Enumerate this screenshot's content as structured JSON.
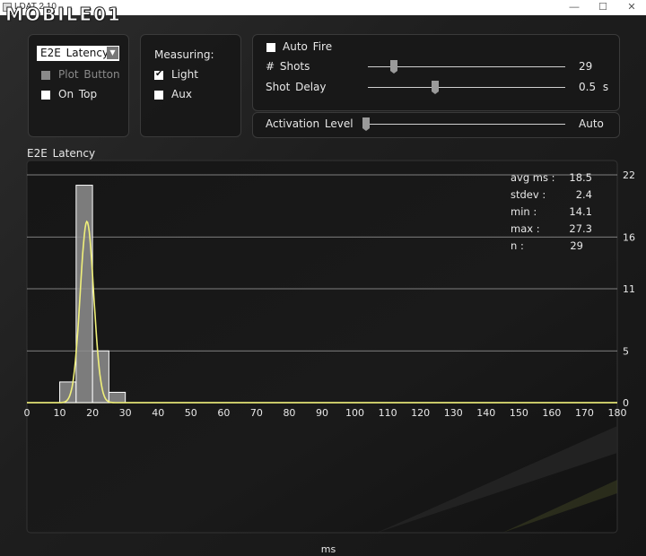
{
  "window": {
    "title": "LDAT 2.10",
    "minimize": "—",
    "maximize": "☐",
    "close": "✕"
  },
  "logo": {
    "text": "MOBILE01"
  },
  "source_panel": {
    "dropdown_value": "E2E Latency",
    "plot_button_label": "Plot Button",
    "plot_button_checked": false,
    "plot_button_enabled": false,
    "on_top_label": "On Top",
    "on_top_checked": false
  },
  "measuring_panel": {
    "heading": "Measuring:",
    "light_label": "Light",
    "light_checked": true,
    "aux_label": "Aux",
    "aux_checked": false
  },
  "fire_panel": {
    "auto_fire_label": "Auto Fire",
    "auto_fire_checked": false,
    "shots_label": "# Shots",
    "shots_value": "29",
    "shots_slider_fraction": 0.13,
    "shot_delay_label": "Shot Delay",
    "shot_delay_value": "0.5 s",
    "shot_delay_slider_fraction": 0.34
  },
  "activation_panel": {
    "label": "Activation Level",
    "value": "Auto",
    "slider_fraction": 0.0
  },
  "stats": {
    "avg_label": "avg ms :",
    "avg_value": "18.5",
    "stdev_label": "stdev :",
    "stdev_value": "2.4",
    "min_label": "min :",
    "min_value": "14.1",
    "max_label": "max :",
    "max_value": "27.3",
    "n_label": "n :",
    "n_value": "29"
  },
  "chart_data": {
    "type": "bar",
    "title": "E2E Latency",
    "xlabel": "ms",
    "ylabel": "",
    "xlim": [
      0,
      180
    ],
    "ylim": [
      0,
      22
    ],
    "x_ticks": [
      0,
      10,
      20,
      30,
      40,
      50,
      60,
      70,
      80,
      90,
      100,
      110,
      120,
      130,
      140,
      150,
      160,
      170,
      180
    ],
    "y_ticks": [
      0,
      5,
      11,
      16,
      22
    ],
    "bin_width": 5,
    "bins": [
      {
        "x_start": 10,
        "count": 2
      },
      {
        "x_start": 15,
        "count": 21
      },
      {
        "x_start": 20,
        "count": 5
      },
      {
        "x_start": 25,
        "count": 1
      }
    ],
    "fit_curve": {
      "type": "gaussian",
      "mean": 18.3,
      "peak": 17.5,
      "sigma": 2.05,
      "color": "#f0f07a"
    },
    "colors": {
      "bar_fill": "#8e8e8e",
      "bar_stroke": "#ffffff",
      "grid": "#cfcfcf",
      "axis": "#f0f07a"
    }
  }
}
